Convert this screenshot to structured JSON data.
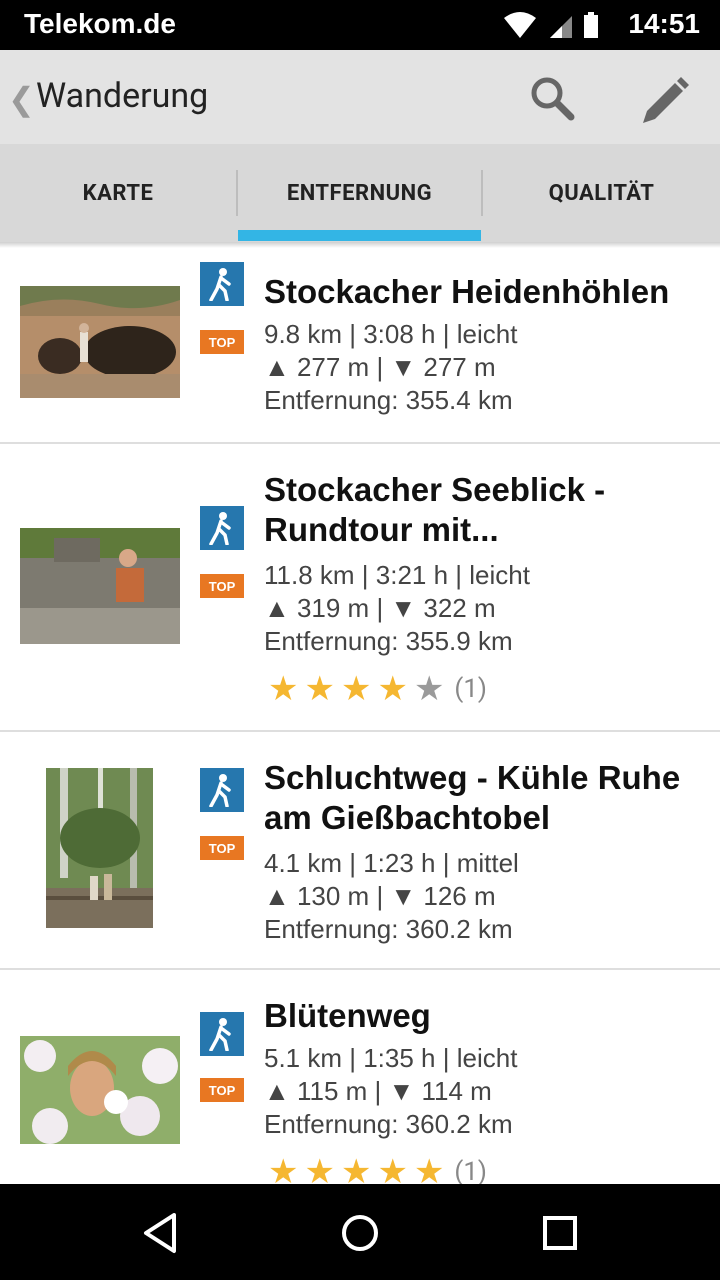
{
  "status_bar": {
    "carrier": "Telekom.de",
    "time": "14:51"
  },
  "action_bar": {
    "title": "Wanderung",
    "icons": [
      "back-chevron-icon",
      "search-icon",
      "pencil-icon"
    ]
  },
  "tabs": [
    {
      "label": "KARTE",
      "selected": false
    },
    {
      "label": "ENTFERNUNG",
      "selected": true
    },
    {
      "label": "QUALITÄT",
      "selected": false
    }
  ],
  "accent_color": "#33b5e5",
  "badge_colors": {
    "walk": "#2677ae",
    "top": "#e87722"
  },
  "badge_text": "TOP",
  "routes": [
    {
      "name_line1": "Stockacher Heidenhöhlen",
      "name_line2": "",
      "stats": "9.8 km | 3:08 h | leicht",
      "ascent_descent": "▲ 277 m | ▼ 277 m",
      "distance": "Entfernung: 355.4 km"
    },
    {
      "name_line1": "Stockacher Seeblick -",
      "name_line2": "Rundtour mit...",
      "stats": "11.8 km | 3:21 h | leicht",
      "ascent_descent": "▲ 319 m | ▼ 322 m",
      "distance": "Entfernung: 355.9 km",
      "rating": 4,
      "rating_count": "(1)"
    },
    {
      "name_line1": "Schluchtweg - Kühle Ruhe",
      "name_line2": "am Gießbachtobel",
      "stats": "4.1 km | 1:23 h | mittel",
      "ascent_descent": "▲ 130 m | ▼ 126 m",
      "distance": "Entfernung: 360.2 km"
    },
    {
      "name_line1": "Blütenweg",
      "name_line2": "",
      "stats": "5.1 km | 1:35 h | leicht",
      "ascent_descent": "▲ 115 m | ▼ 114 m",
      "distance": "Entfernung: 360.2 km",
      "rating": 5,
      "rating_count": "(1)"
    }
  ]
}
